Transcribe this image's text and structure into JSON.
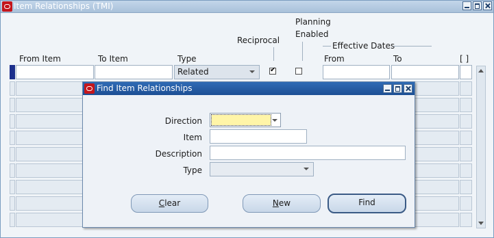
{
  "window": {
    "title": "Item Relationships (TMI)"
  },
  "columns": {
    "from_item": "From Item",
    "to_item": "To Item",
    "type": "Type",
    "reciprocal": "Reciprocal",
    "planning_enabled_line1": "Planning",
    "planning_enabled_line2": "Enabled",
    "effective_dates": "Effective Dates",
    "from": "From",
    "to": "To",
    "folder_brackets": "[ ]"
  },
  "first_row": {
    "type_value": "Related",
    "reciprocal_checked": true,
    "planning_enabled_checked": false
  },
  "dialog": {
    "title": "Find Item Relationships",
    "direction_label": "Direction",
    "direction_value": "",
    "item_label": "Item",
    "item_value": "",
    "description_label": "Description",
    "description_value": "",
    "type_label": "Type",
    "type_value": "",
    "clear_hotkey": "C",
    "clear_rest": "lear",
    "new_hotkey": "N",
    "new_rest": "ew",
    "find_label": "Find"
  },
  "colors": {
    "title_bar_inactive": "#a9c1da",
    "title_bar_active": "#1d4f94",
    "focus_field": "#fff5a8",
    "current_record": "#1c2f8c"
  }
}
